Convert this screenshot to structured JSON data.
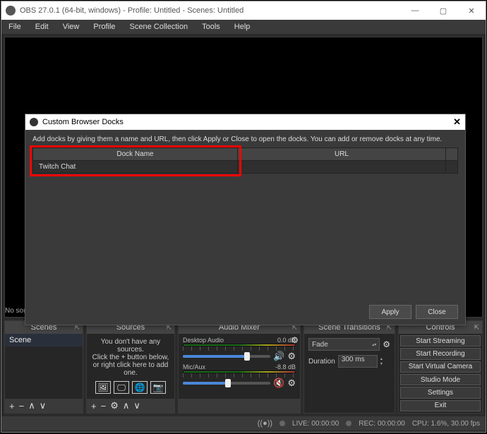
{
  "window": {
    "title": "OBS 27.0.1 (64-bit, windows) - Profile: Untitled - Scenes: Untitled"
  },
  "menu": {
    "file": "File",
    "edit": "Edit",
    "view": "View",
    "profile": "Profile",
    "scene_collection": "Scene Collection",
    "tools": "Tools",
    "help": "Help"
  },
  "no_sources_text": "No sour",
  "panel_titles": {
    "scenes": "Scenes",
    "sources": "Sources",
    "mixer": "Audio Mixer",
    "transitions": "Scene Transitions",
    "controls": "Controls"
  },
  "scenes": {
    "items": [
      "Scene"
    ]
  },
  "sources_placeholder_l1": "You don't have any sources.",
  "sources_placeholder_l2": "Click the + button below,",
  "sources_placeholder_l3": "or right click here to add one.",
  "mixer": {
    "ch1_name": "Desktop Audio",
    "ch1_db": "0.0 dB",
    "ch2_name": "Mic/Aux",
    "ch2_db": "-8.8 dB"
  },
  "transitions": {
    "selected": "Fade",
    "duration_label": "Duration",
    "duration_value": "300 ms"
  },
  "controls": {
    "start_streaming": "Start Streaming",
    "start_recording": "Start Recording",
    "start_vcam": "Start Virtual Camera",
    "studio_mode": "Studio Mode",
    "settings": "Settings",
    "exit": "Exit"
  },
  "status": {
    "live": "LIVE: 00:00:00",
    "rec": "REC: 00:00:00",
    "cpu": "CPU: 1.6%, 30.00 fps"
  },
  "modal": {
    "title": "Custom Browser Docks",
    "instructions": "Add docks by giving them a name and URL, then click Apply or Close to open the docks. You can add or remove docks at any time.",
    "col_name": "Dock Name",
    "col_url": "URL",
    "row0_name": "Twitch Chat",
    "row0_url": "",
    "apply": "Apply",
    "close": "Close"
  }
}
